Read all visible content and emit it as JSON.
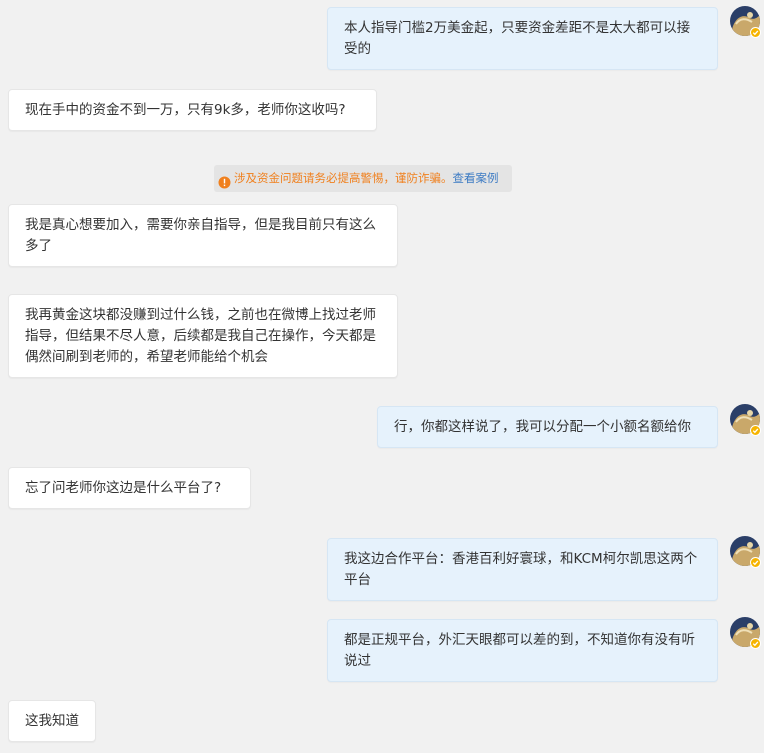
{
  "colors": {
    "background": "#f1f1f1",
    "incoming_bubble": "#ffffff",
    "outgoing_bubble": "#e6f2fc",
    "warning_text": "#f0801e",
    "warning_link": "#3d7bc3",
    "verified_badge": "#f6b400"
  },
  "warning": {
    "icon": "info-circle-icon",
    "text": "涉及资金问题请务必提高警惕，谨防诈骗。",
    "link": "查看案例"
  },
  "messages": [
    {
      "direction": "outgoing",
      "text": "本人指导门槛2万美金起，只要资金差距不是太大都可以接受的"
    },
    {
      "direction": "incoming",
      "text": "现在手中的资金不到一万，只有9k多，老师你这收吗?"
    },
    {
      "direction": "incoming",
      "text": "我是真心想要加入，需要你亲自指导，但是我目前只有这么多了"
    },
    {
      "direction": "incoming",
      "text": "我再黄金这块都没赚到过什么钱，之前也在微博上找过老师指导，但结果不尽人意，后续都是我自己在操作，今天都是偶然间刷到老师的，希望老师能给个机会"
    },
    {
      "direction": "outgoing",
      "text": "行，你都这样说了，我可以分配一个小额名额给你"
    },
    {
      "direction": "incoming",
      "text": "忘了问老师你这边是什么平台了?"
    },
    {
      "direction": "outgoing",
      "text": "我这边合作平台：香港百利好寰球，和KCM柯尔凯思这两个平台"
    },
    {
      "direction": "outgoing",
      "text": "都是正规平台，外汇天眼都可以差的到，不知道你有没有听说过"
    },
    {
      "direction": "incoming",
      "text": "这我知道"
    }
  ]
}
